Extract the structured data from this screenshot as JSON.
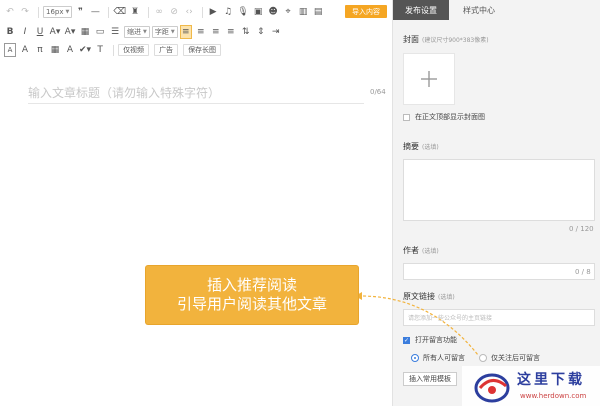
{
  "editor": {
    "font_size": "16px",
    "indent_select": "缩进",
    "spacing_select": "字距",
    "text_buttons": [
      "仅视频",
      "广告",
      "保存长图"
    ],
    "import_button": "导入内容",
    "title_placeholder": "输入文章标题（请勿输入特殊字符）",
    "title_counter": "0/64"
  },
  "panel": {
    "tabs": [
      "发布设置",
      "样式中心"
    ],
    "cover_label": "封面",
    "cover_hint": "(建议尺寸900*383像素)",
    "cover_option": "在正文顶部显示封面图",
    "summary_label": "摘要",
    "optional": "(选填)",
    "summary_counter": "0 / 120",
    "author_label": "作者",
    "author_counter": "0 / 8",
    "source_label": "原文链接",
    "source_placeholder": "请您添加一些公众号的主页链接",
    "comment_toggle": "打开留言功能",
    "radio_all": "所有人可留言",
    "radio_followers": "仅关注后可留言",
    "insert_template": "插入常用模板"
  },
  "callout": {
    "line1": "插入推荐阅读",
    "line2": "引导用户阅读其他文章"
  },
  "watermark": {
    "text": "这里下载",
    "url": "www.herdown.com"
  },
  "colors": {
    "accent_orange": "#f5a623",
    "callout": "#f2b33d",
    "tab_active": "#555555",
    "link_blue": "#3b7ddd"
  }
}
